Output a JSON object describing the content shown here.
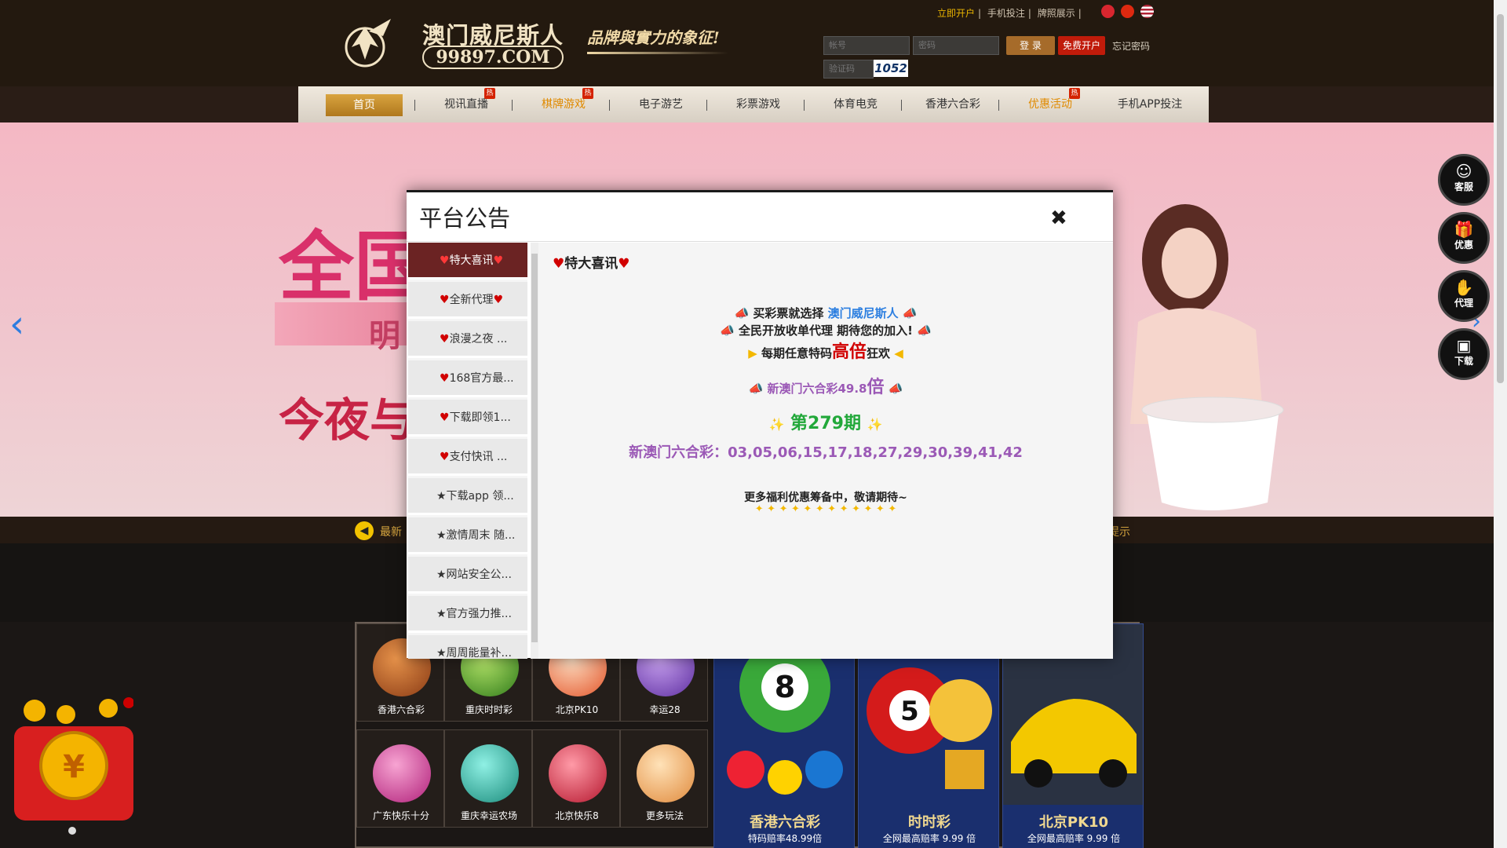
{
  "header": {
    "logo_cn": "澳门威尼斯人",
    "logo_domain": "99897.COM",
    "slogan": "品牌與實力的象征!",
    "top_links": [
      "立即开户",
      "手机投注",
      "牌照展示"
    ],
    "account_placeholder": "帐号",
    "password_placeholder": "密码",
    "captcha_placeholder": "验证码",
    "captcha_code": "1052",
    "login_label": "登 录",
    "register_label": "免费开户",
    "forgot_label": "忘记密码"
  },
  "nav": {
    "items": [
      "首页",
      "视讯直播",
      "棋牌游戏",
      "电子游艺",
      "彩票游戏",
      "体育电竞",
      "香港六合彩",
      "优惠活动",
      "手机APP投注"
    ],
    "hot_label": "热"
  },
  "banner": {
    "line1": "全国",
    "line2": "明",
    "line3": "今夜与你"
  },
  "side_buttons": [
    "客服",
    "优惠",
    "代理",
    "下载"
  ],
  "ticker": {
    "left_text": "最新",
    "right_text": "提示"
  },
  "games": {
    "small": [
      "香港六合彩",
      "重庆时时彩",
      "北京PK10",
      "幸运28",
      "广东快乐十分",
      "重庆幸运农场",
      "北京快乐8",
      "更多玩法"
    ],
    "big": [
      {
        "title": "香港六合彩",
        "subtitle": "特码赔率48.99倍"
      },
      {
        "title": "时时彩",
        "subtitle": "全网最高赔率 9.99 倍"
      },
      {
        "title": "北京PK10",
        "subtitle": "全网最高赔率 9.99 倍"
      }
    ]
  },
  "modal": {
    "title": "平台公告",
    "close_icon": "close-icon",
    "tabs": [
      "特大喜讯",
      "全新代理",
      "浪漫之夜 ...",
      "168官方最...",
      "下载即领1...",
      "支付快讯 ...",
      "★下载app 领...",
      "★激情周末 随...",
      "★网站安全公...",
      "★官方强力推...",
      "★周周能量补..."
    ],
    "heading": "特大喜讯",
    "line1_prefix": "买彩票就选择 ",
    "line1_brand": "澳门威尼斯人",
    "line2": "全民开放收单代理 期待您的加入!",
    "line3_a": "每期任意特码",
    "line3_b": "高倍",
    "line3_c": "狂欢",
    "line4_a": "新澳门六合彩49.8",
    "line4_b": "倍",
    "period": "第279期",
    "numbers_label": "新澳门六合彩：",
    "numbers": "03,05,06,15,17,18,27,29,30,39,41,42",
    "footer": "更多福利优惠筹备中，敬请期待~",
    "stars": "✦ ✦ ✦ ✦ ✦ ✦ ✦ ✦ ✦ ✦ ✦ ✦"
  },
  "colors": {
    "header_bg": "#23190f",
    "accent_gold": "#d9a43f",
    "tab_active": "#6b2323",
    "brand_blue": "#2b7ee0",
    "highlight_red": "#d10000",
    "purple": "#9b59b6",
    "green": "#22a83a"
  }
}
